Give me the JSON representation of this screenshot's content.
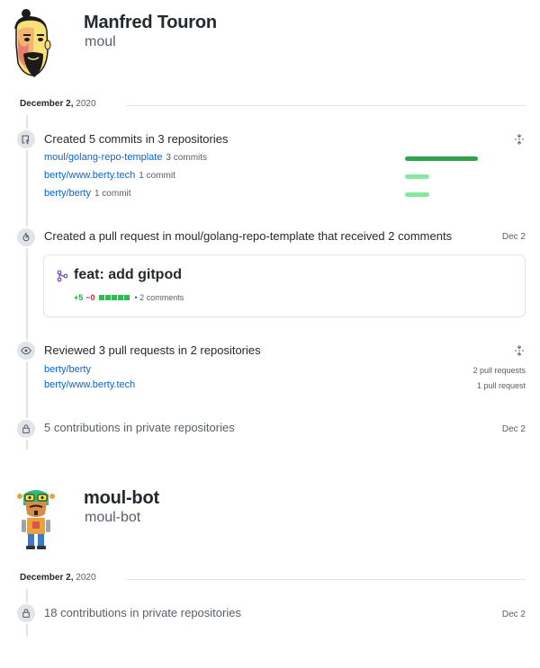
{
  "users": [
    {
      "name": "Manfred Touron",
      "login": "moul",
      "date_bold": "December 2,",
      "date_year": " 2020"
    },
    {
      "name": "moul-bot",
      "login": "moul-bot",
      "date_bold": "December 2,",
      "date_year": " 2020"
    }
  ],
  "activity": {
    "commits": {
      "title": "Created 5 commits in 3 repositories",
      "repos": [
        {
          "name": "moul/golang-repo-template",
          "count": "3 commits",
          "share": 0.6
        },
        {
          "name": "berty/www.berty.tech",
          "count": "1 commit",
          "share": 0.2
        },
        {
          "name": "berty/berty",
          "count": "1 commit",
          "share": 0.2
        }
      ]
    },
    "pull_request": {
      "title": "Created a pull request in moul/golang-repo-template that received 2 comments",
      "date": "Dec 2",
      "pr_title": "feat: add gitpod",
      "additions": "+5",
      "deletions": "−0",
      "comments": "• 2 comments"
    },
    "reviews": {
      "title": "Reviewed 3 pull requests in 2 repositories",
      "repos": [
        {
          "name": "berty/berty",
          "count": "2 pull requests"
        },
        {
          "name": "berty/www.berty.tech",
          "count": "1 pull request"
        }
      ]
    },
    "private": {
      "title": "5 contributions in private repositories",
      "date": "Dec 2"
    }
  },
  "bot_activity": {
    "private": {
      "title": "18 contributions in private repositories",
      "date": "Dec 2"
    }
  },
  "colors": {
    "link": "#0366d6",
    "bar_dark": "#2ea44f",
    "bar_light": "#85e89d",
    "additions": "#28a745",
    "deletions": "#cb2431",
    "pr_icon": "#6f42c1"
  },
  "icons": [
    "repo-push-icon",
    "fold-icon",
    "git-pull-request-icon",
    "pr-merged-icon",
    "eye-icon",
    "lock-icon"
  ]
}
